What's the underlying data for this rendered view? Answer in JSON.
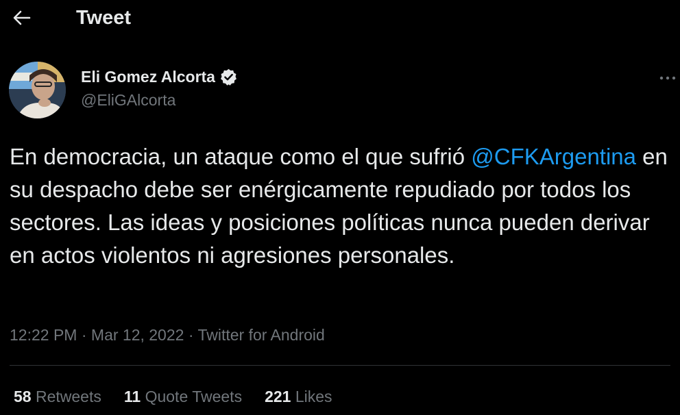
{
  "header": {
    "title": "Tweet",
    "back_icon": "arrow-left-icon"
  },
  "author": {
    "name": "Eli Gomez Alcorta",
    "handle": "@EliGAlcorta",
    "verified_icon": "verified-badge-icon",
    "more_icon": "more-horizontal-icon"
  },
  "tweet": {
    "text_before": "En democracia, un ataque como el que sufrió ",
    "mention": "@CFKArgentina",
    "text_after": " en su despacho debe ser enérgicamente repudiado por todos los sectores. Las ideas y posiciones políticas nunca pueden derivar en actos violentos ni agresiones personales.",
    "time": "12:22 PM",
    "separator1": " · ",
    "date": "Mar 12, 2022",
    "separator2": " · ",
    "source": "Twitter for Android"
  },
  "stats": {
    "retweets_count": "58",
    "retweets_label": " Retweets",
    "quotes_count": "11",
    "quotes_label": " Quote Tweets",
    "likes_count": "221",
    "likes_label": " Likes"
  },
  "colors": {
    "background": "#000000",
    "text": "#e7e9ea",
    "secondary": "#71767b",
    "accent": "#1d9bf0",
    "divider": "#2f3336"
  }
}
